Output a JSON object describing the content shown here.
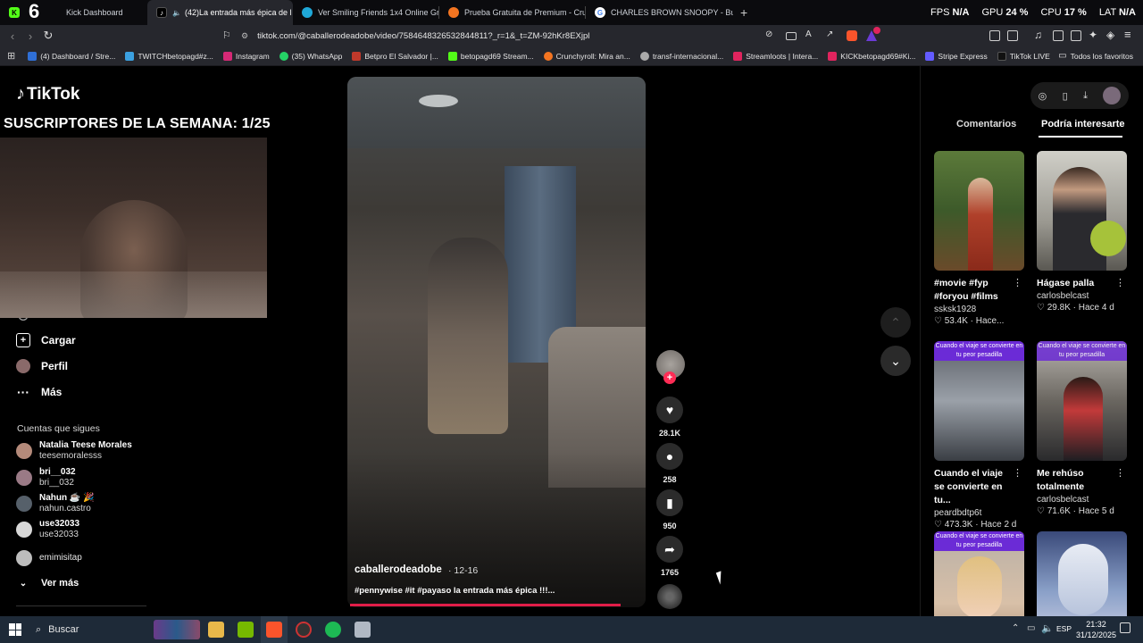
{
  "browser": {
    "tabs": [
      {
        "label": "Kick Dashboard",
        "active": false
      },
      {
        "label": "(42)La entrada más épica de l",
        "active": true
      },
      {
        "label": "Ver Smiling Friends 1x4 Online Gratis",
        "active": false
      },
      {
        "label": "Prueba Gratuita de Premium - Crunch",
        "active": false
      },
      {
        "label": "CHARLES BROWN SNOOPY - Buscar",
        "active": false
      }
    ],
    "overlay_number": "6",
    "stats": {
      "fps_label": "FPS",
      "fps_value": "N/A",
      "gpu_label": "GPU",
      "gpu_value": "24 %",
      "cpu_label": "CPU",
      "cpu_value": "17 %",
      "lat_label": "LAT",
      "lat_value": "N/A"
    },
    "url": "tiktok.com/@caballerodeadobe/video/7584648326532844811?_r=1&_t=ZM-92hKr8EXjpl",
    "bookmarks": [
      {
        "label": "(4) Dashboard / Stre...",
        "color": "#2f6fd6"
      },
      {
        "label": "TWITCHbetopagd#z...",
        "color": "#3ba0e0"
      },
      {
        "label": "Instagram",
        "color": "#d62976"
      },
      {
        "label": "(35) WhatsApp",
        "color": "#25d366"
      },
      {
        "label": "Betpro El Salvador |...",
        "color": "#c0392b"
      },
      {
        "label": "betopagd69 Stream...",
        "color": "#53fc18"
      },
      {
        "label": "Crunchyroll: Mira an...",
        "color": "#f47521"
      },
      {
        "label": "transf-internacional...",
        "color": "#aaaaaa"
      },
      {
        "label": "Streamloots | Intera...",
        "color": "#e0245e"
      },
      {
        "label": "KICKbetopagd69#Ki...",
        "color": "#e0245e"
      },
      {
        "label": "Stripe Express",
        "color": "#635bff"
      },
      {
        "label": "TikTok LIVE",
        "color": "#111111"
      }
    ],
    "bookmarks_all": "Todos los favoritos"
  },
  "tiktok": {
    "logo": "TikTok",
    "overlay_text": "SUSCRIPTORES DE LA SEMANA: 1/25",
    "nav": [
      {
        "label": "Actividad"
      },
      {
        "label": "Cargar"
      },
      {
        "label": "Perfil"
      },
      {
        "label": "Más"
      }
    ],
    "following_title": "Cuentas que sigues",
    "following": [
      {
        "name": "Natalia Teese Morales",
        "handle": "teesemoralesss"
      },
      {
        "name": "bri__032",
        "handle": "bri__032"
      },
      {
        "name": "Nahun ☕ 🎉",
        "handle": "nahun.castro"
      },
      {
        "name": "use32033",
        "handle": "use32033"
      },
      {
        "name": "emimisitap",
        "handle": ""
      }
    ],
    "see_more": "Ver más",
    "video": {
      "username": "caballerodeadobe",
      "date": "· 12-16",
      "caption": "#pennywise #it #payaso la entrada más épica !!!..."
    },
    "actions": {
      "likes": "28.1K",
      "comments": "258",
      "saves": "950",
      "shares": "1765"
    },
    "right_panel": {
      "tab_comments": "Comentarios",
      "tab_related": "Podría interesarte",
      "cards": [
        {
          "title": "#movie #fyp #foryou #films",
          "author": "ssksk1928",
          "stats": "53.4K · Hace..."
        },
        {
          "title": "Hágase palla",
          "author": "carlosbelcast",
          "stats": "29.8K · Hace 4 d"
        },
        {
          "title": "Cuando el viaje se convierte en tu...",
          "author": "peardbdtp6t",
          "stats": "473.3K · Hace 2 d",
          "banner": "Cuando el viaje se convierte en tu peor pesadilla"
        },
        {
          "title": "Me rehúso totalmente",
          "author": "carlosbelcast",
          "stats": "71.6K · Hace 5 d",
          "banner": "Cuando el viaje se convierte en tu peor pesadilla"
        },
        {
          "title": "",
          "author": "",
          "stats": "",
          "banner": "Cuando el viaje se convierte en tu peor pesadilla"
        },
        {
          "title": "",
          "author": "",
          "stats": ""
        }
      ]
    }
  },
  "taskbar": {
    "search": "Buscar",
    "lang": "ESP",
    "time": "21:32",
    "date": "31/12/2025"
  }
}
